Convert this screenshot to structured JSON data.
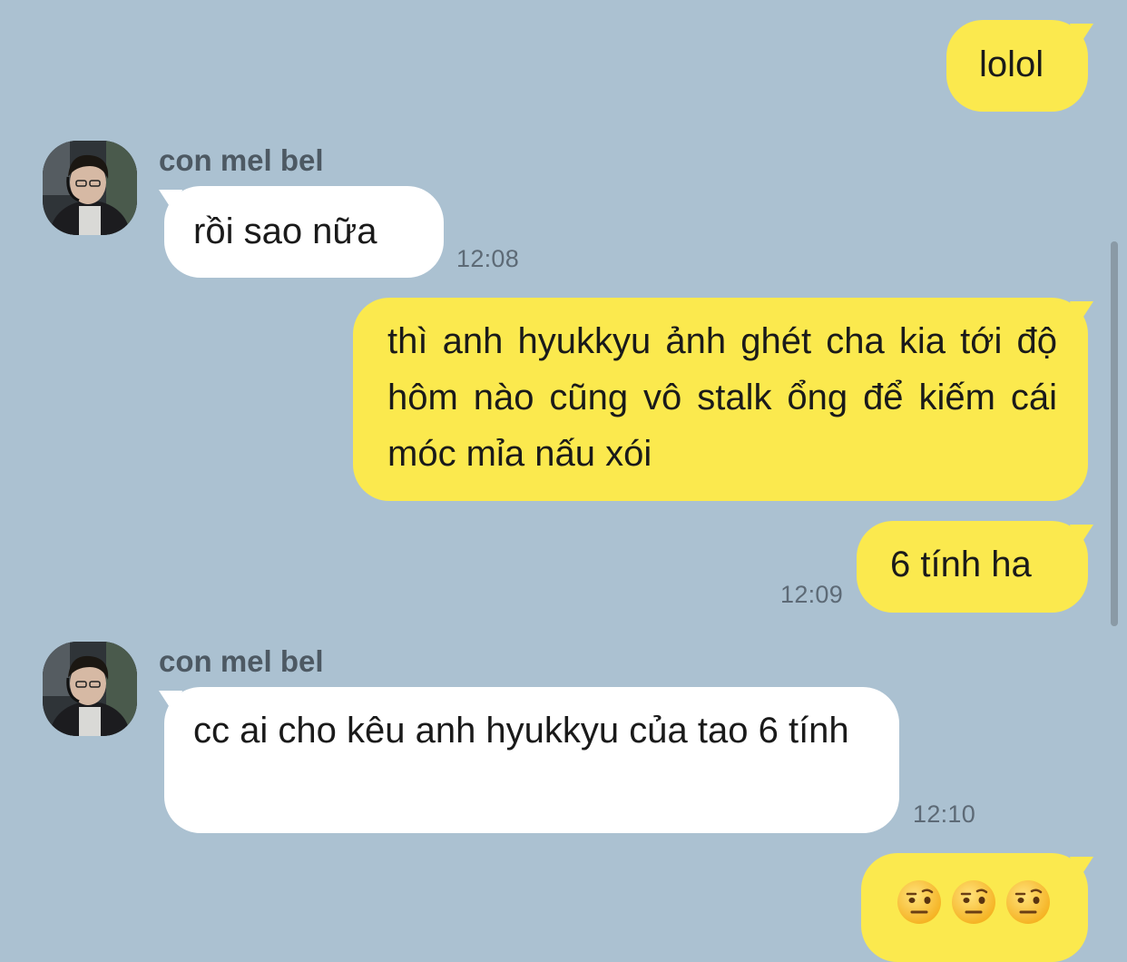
{
  "messages": [
    {
      "side": "mine",
      "text": "lolol"
    },
    {
      "side": "theirs",
      "sender": "con mel bel",
      "text": "rồi sao nữa",
      "time": "12:08"
    },
    {
      "side": "mine",
      "text": "thì anh hyukkyu ảnh ghét cha kia tới độ hôm nào cũng vô stalk ổng để kiếm cái móc mỉa nấu xói"
    },
    {
      "side": "mine",
      "text": "6 tính ha",
      "time": "12:09"
    },
    {
      "side": "theirs",
      "sender": "con mel bel",
      "text": "cc ai cho kêu anh hyukkyu của tao 6 tính",
      "time": "12:10"
    },
    {
      "side": "mine",
      "emoji": [
        "face-with-raised-eyebrow",
        "face-with-raised-eyebrow",
        "face-with-raised-eyebrow"
      ]
    }
  ],
  "colors": {
    "background": "#abc1d1",
    "my_bubble": "#fbe94e",
    "their_bubble": "#ffffff"
  }
}
